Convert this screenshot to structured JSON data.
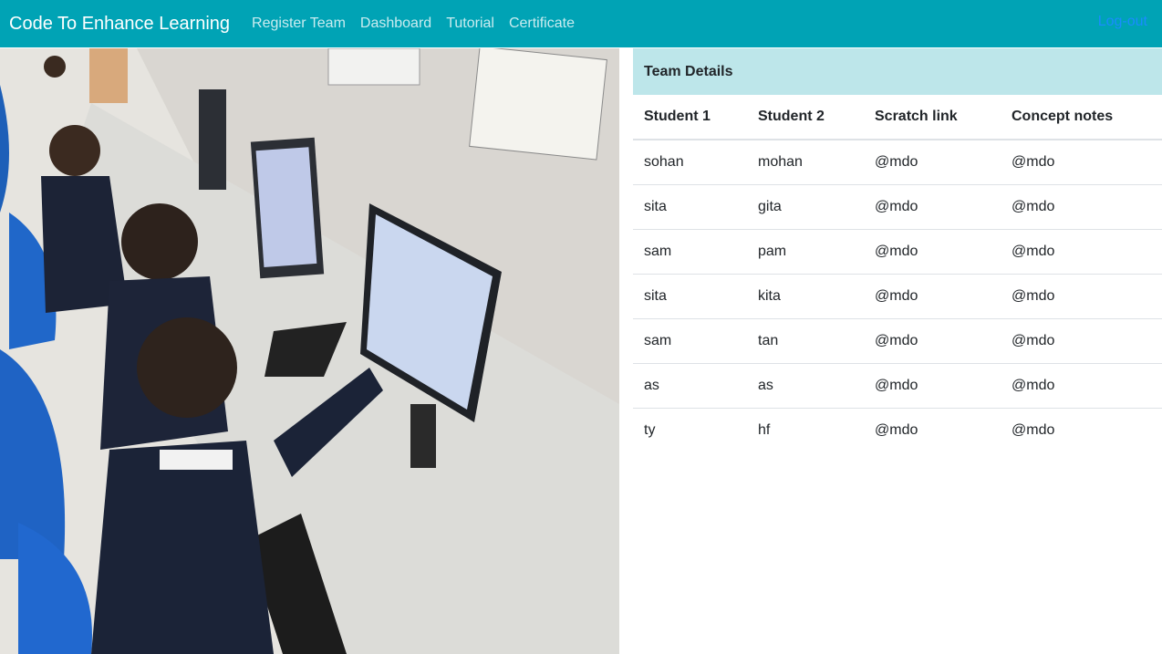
{
  "nav": {
    "brand": "Code To Enhance Learning",
    "links": [
      "Register Team",
      "Dashboard",
      "Tutorial",
      "Certificate"
    ],
    "logout": "Log-out"
  },
  "team": {
    "title": "Team Details",
    "columns": [
      "Student 1",
      "Student 2",
      "Scratch link",
      "Concept notes"
    ],
    "rows": [
      [
        "sohan",
        "mohan",
        "@mdo",
        "@mdo"
      ],
      [
        "sita",
        "gita",
        "@mdo",
        "@mdo"
      ],
      [
        "sam",
        "pam",
        "@mdo",
        "@mdo"
      ],
      [
        "sita",
        "kita",
        "@mdo",
        "@mdo"
      ],
      [
        "sam",
        "tan",
        "@mdo",
        "@mdo"
      ],
      [
        "as",
        "as",
        "@mdo",
        "@mdo"
      ],
      [
        "ty",
        "hf",
        "@mdo",
        "@mdo"
      ]
    ]
  }
}
